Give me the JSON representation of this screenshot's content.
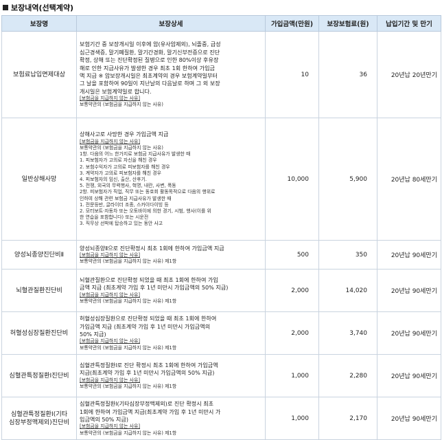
{
  "section": {
    "title": "보장내역(선택계약)"
  },
  "headers": [
    "보장명",
    "보장상세",
    "가입금액(만원)",
    "보장보험료(원)",
    "납입기간 및 만기"
  ],
  "rows": [
    {
      "name": [
        "보험료납입면제대상"
      ],
      "detail": [
        {
          "t": "보험기간 중 보장개시일 이후에 암(유사암제외), 뇌졸중, 급성",
          "s": false
        },
        {
          "t": "심근경색증, 말기폐질환, 말기간경화, 말기신부전증으로 진단",
          "s": false
        },
        {
          "t": "확정, 상해 또는 진단확정된 질병으로 인한 80%이상 후유장",
          "s": false
        },
        {
          "t": "해로 인한 지급사유가 발생한 경우 최초 1회 한하여 가입금",
          "s": false
        },
        {
          "t": "액 지급 ※ 암보장개시일은 최초계약의 경우 보험계약일부터",
          "s": false
        },
        {
          "t": "그 날을 포함하여 90일이 지난날의 다음날로 하며 그 외 보장",
          "s": false
        },
        {
          "t": "개시일은 보험계약일로 합니다.",
          "s": false
        },
        {
          "t": "[보험금을 지급하지 않는 사유]",
          "s": true,
          "u": true
        },
        {
          "t": "보통약관의 (보험금을 지급하지 않는 사유)",
          "s": true
        }
      ],
      "amount": "10",
      "premium": "36",
      "period": "20년납 20년만기"
    },
    {
      "name": [
        "일반상해사망"
      ],
      "detail": [
        {
          "t": "상해사고로 사망한 경우 가입금액 지급",
          "s": false
        },
        {
          "t": "[보험금을 지급하지 않는 사유]",
          "s": true,
          "u": true
        },
        {
          "t": "보통약관의 (보험금을 지급하지 않는 사유)",
          "s": true
        },
        {
          "t": "1항. 다음의 어느 한가지로 보험금 지급사유가 발생한 때",
          "s": true
        },
        {
          "t": "1. 피보험자가 고의로 자신을 해친 경우",
          "s": true
        },
        {
          "t": "2. 보험수익자가 고의로 피보험자를 해친 경우",
          "s": true
        },
        {
          "t": "3. 계약자가 고의로 피보험자를 해친 경우",
          "s": true
        },
        {
          "t": "4. 피보험자의 임신, 출산, 산후기.",
          "s": true
        },
        {
          "t": "5. 전쟁, 외국의 무력행사, 혁명, 내란, 사변, 폭동",
          "s": true
        },
        {
          "t": "2항. 피보험자가 직업, 직무 또는 동호회 활동목적으로 다음의 행위로",
          "s": true
        },
        {
          "t": "인하여 상해 관련 보험금 지급사유가 발생한 때",
          "s": true
        },
        {
          "t": "1. 전문등반, 글라이더 조종, 스카이다이빙 등",
          "s": true
        },
        {
          "t": "2. 모터보트·자동차 또는 오토바이에 의한 경기, 시범, 행사(이를 위",
          "s": true
        },
        {
          "t": "한 연습을 포함합니다) 또는 시운전",
          "s": true
        },
        {
          "t": "3. 직무상 선박에 탑승하고 있는 동안 사고",
          "s": true
        }
      ],
      "amount": "10,000",
      "premium": "5,900",
      "period": "20년납 80세만기"
    },
    {
      "name": [
        "양성뇌종양진단비Ⅱ"
      ],
      "detail": [
        {
          "t": "양성뇌종양Ⅱ으로 진단확정시 최초 1회에 한하여 가입금액 지급",
          "s": false
        },
        {
          "t": "[보험금을 지급하지 않는 사유]",
          "s": true,
          "u": true
        },
        {
          "t": "보통약관의 (보험금을 지급하지 않는 사유) 제1항",
          "s": true
        }
      ],
      "amount": "500",
      "premium": "350",
      "period": "20년납 90세만기"
    },
    {
      "name": [
        "뇌혈관질환진단비"
      ],
      "detail": [
        {
          "t": "뇌혈관질환으로 진단확정 되었을 때 최초 1회에 한하여 가입",
          "s": false
        },
        {
          "t": "금액 지급 (최초계약 가입 후 1년 미만시 가입금액의 50% 지급)",
          "s": false
        },
        {
          "t": "[보험금을 지급하지 않는 사유]",
          "s": true,
          "u": true
        },
        {
          "t": "보통약관의 (보험금을 지급하지 않는 사유) 제1항",
          "s": true
        }
      ],
      "amount": "2,000",
      "premium": "14,020",
      "period": "20년납 90세만기"
    },
    {
      "name": [
        "허혈성심장질환진단비"
      ],
      "detail": [
        {
          "t": "허혈성심장질환으로 진단확정 되었을 때 최초 1회에 한하여",
          "s": false
        },
        {
          "t": "가입금액 지급 (최초계약 가입 후 1년 미만시 가입금액의",
          "s": false
        },
        {
          "t": "50% 지급)",
          "s": false
        },
        {
          "t": "[보험금을 지급하지 않는 사유]",
          "s": true,
          "u": true
        },
        {
          "t": "보통약관의 (보험금을 지급하지 않는 사유) 제1항",
          "s": true
        }
      ],
      "amount": "2,000",
      "premium": "3,740",
      "period": "20년납 90세만기"
    },
    {
      "name": [
        "심혈관특정질환Ⅰ진단비"
      ],
      "detail": [
        {
          "t": "심혈관특정질환Ⅰ로 진단 확정시 최초 1회에 한하여 가입금액",
          "s": false
        },
        {
          "t": "지급(최초계약 가입 후 1년 미만시 가입금액의 50% 지급)",
          "s": false
        },
        {
          "t": "[보험금을 지급하지 않는 사유]",
          "s": true,
          "u": true
        },
        {
          "t": "보통약관의 (보험금을 지급하지 않는 사유) 제1항",
          "s": true
        }
      ],
      "amount": "1,000",
      "premium": "2,280",
      "period": "20년납 90세만기"
    },
    {
      "name": [
        "심혈관특정질환Ⅰ(기타",
        "심장부정맥제외)진단비"
      ],
      "detail": [
        {
          "t": "심혈관특정질환Ⅰ(기타심장부정맥제외)로 진단 확정시 최초",
          "s": false
        },
        {
          "t": "1회에 한하여 가입금액 지급(최초계약 가입 후 1년 미만시 가",
          "s": false
        },
        {
          "t": "입금액의 50% 지급)",
          "s": false
        },
        {
          "t": "[보험금을 지급하지 않는 사유]",
          "s": true,
          "u": true
        },
        {
          "t": "보통약관의 (보험금을 지급하지 않는 사유) 제1항",
          "s": true
        }
      ],
      "amount": "1,000",
      "premium": "2,170",
      "period": "20년납 90세만기"
    }
  ]
}
